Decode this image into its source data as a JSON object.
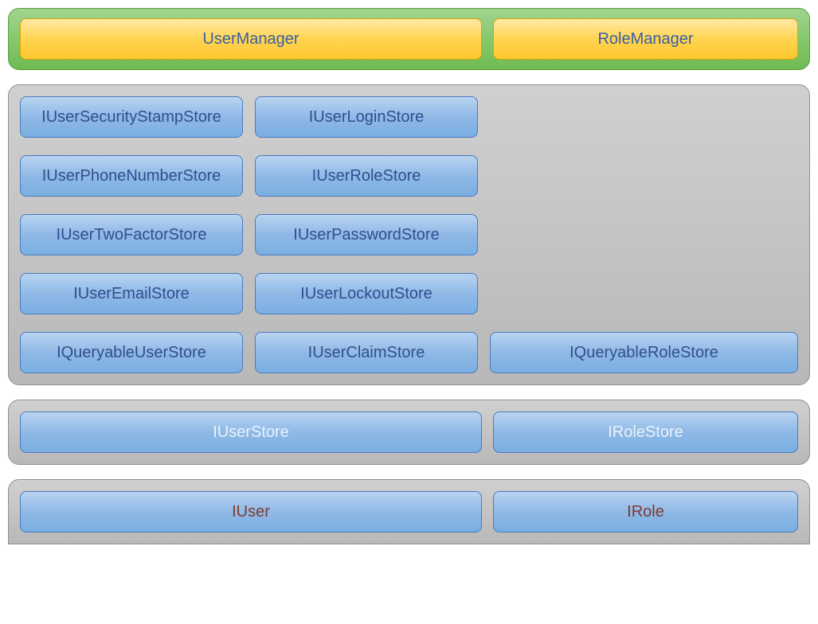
{
  "managers": {
    "user": "UserManager",
    "role": "RoleManager"
  },
  "interfaces": {
    "colA": [
      "IUserSecurityStampStore",
      "IUserPhoneNumberStore",
      "IUserTwoFactorStore",
      "IUserEmailStore",
      "IQueryableUserStore"
    ],
    "colB": [
      "IUserLoginStore",
      "IUserRoleStore",
      "IUserPasswordStore",
      "IUserLockoutStore",
      "IUserClaimStore"
    ],
    "colC": "IQueryableRoleStore"
  },
  "stores": {
    "user": "IUserStore",
    "role": "IRoleStore"
  },
  "entities": {
    "user": "IUser",
    "role": "IRole"
  }
}
